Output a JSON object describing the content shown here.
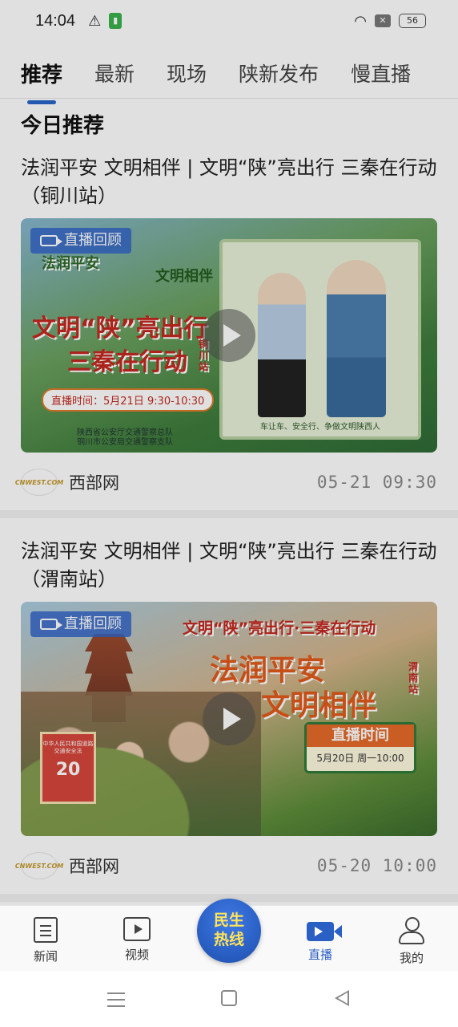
{
  "status_bar": {
    "time": "14:04",
    "battery": "56"
  },
  "tabs": [
    {
      "label": "推荐",
      "active": true
    },
    {
      "label": "最新"
    },
    {
      "label": "现场"
    },
    {
      "label": "陕新发布"
    },
    {
      "label": "慢直播"
    }
  ],
  "section_title": "今日推荐",
  "cards": [
    {
      "title": "法润平安 文明相伴 | 文明“陕”亮出行 三秦在行动（铜川站）",
      "badge": "直播回顾",
      "poster": {
        "head1": "法润平安",
        "head2": "文明相伴",
        "head3": "文明“陕”亮出行",
        "head4": "三秦在行动",
        "station": "铜川站",
        "time_chip": "直播时间：5月21日 9:30-10:30",
        "org1": "陕西省公安厅交通警察总队",
        "org2": "铜川市公安局交通警察支队",
        "slogan": "车让车、安全行、争做文明陕西人"
      },
      "source": "西部网",
      "logo_text": "CNWEST.COM",
      "date": "05-21  09:30"
    },
    {
      "title": "法润平安 文明相伴 | 文明“陕”亮出行 三秦在行动（渭南站）",
      "badge": "直播回顾",
      "poster": {
        "head1": "文明“陕”亮出行·三秦在行动",
        "head2": "法润平安",
        "head3": "文明相伴",
        "station": "渭南站",
        "time_title": "直播时间",
        "time_value": "5月20日 周一10:00",
        "book": "中华人民共和国道路交通安全法",
        "book_num": "20"
      },
      "source": "西部网",
      "logo_text": "CNWEST.COM",
      "date": "05-20  10:00"
    }
  ],
  "bottom_nav": {
    "items": [
      {
        "label": "新闻",
        "icon": "news-icon"
      },
      {
        "label": "视频",
        "icon": "video-icon"
      },
      {
        "label": "直播",
        "icon": "live-icon",
        "active": true
      },
      {
        "label": "我的",
        "icon": "profile-icon"
      }
    ],
    "center": {
      "line1": "民生",
      "line2": "热线"
    }
  },
  "colors": {
    "accent": "#2a5fc4",
    "tab_indicator": "#2a66c9",
    "hotline_text": "#ffe35a"
  }
}
